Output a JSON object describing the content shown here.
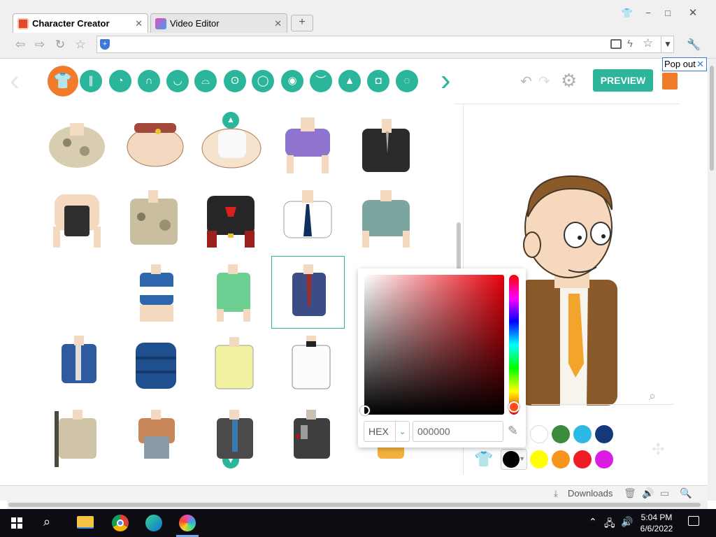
{
  "browser": {
    "tabs": [
      {
        "label": "Character Creator",
        "active": true
      },
      {
        "label": "Video Editor",
        "active": false
      }
    ],
    "new_tab": "+",
    "window_controls": [
      "shirt",
      "−",
      "□",
      "✕"
    ],
    "popout_label": "Pop out",
    "popout_close": "✕"
  },
  "toolbar": {
    "categories": [
      "shirt-icon",
      "pants-icon",
      "face-icon",
      "hair-icon",
      "jaw-icon",
      "mouth-icon",
      "ear-icon",
      "head-shape-icon",
      "eye-icon",
      "eyebrow-icon",
      "nose-icon",
      "glasses-icon",
      "accessory-icon"
    ],
    "preview_label": "PREVIEW",
    "accent": "#2bb59a",
    "selected_accent": "#f07b2a"
  },
  "picker": {
    "mode_label": "HEX",
    "hex_value": "000000",
    "swatches_row1": [
      "#ffffff",
      "#3b8a3e",
      "#2eb8e6",
      "#123a7a"
    ],
    "swatches_row2": [
      "#000000",
      "#ffff00",
      "#f7941d",
      "#ef1c24",
      "#d91ce3"
    ]
  },
  "statusbar": {
    "downloads_label": "Downloads"
  },
  "taskbar": {
    "time": "5:04 PM",
    "date": "6/6/2022"
  }
}
